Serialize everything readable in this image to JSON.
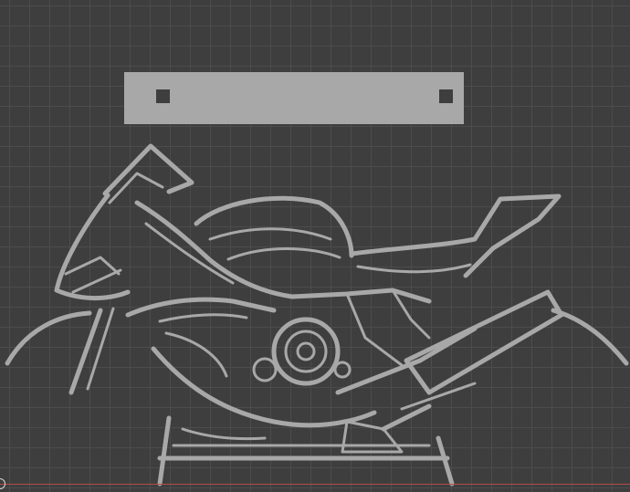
{
  "canvas": {
    "background": "#3e3e3e",
    "grid_color": "#4c4c4c",
    "shape_color": "#a8a8a8",
    "hole_color": "#3e3e3e",
    "edge_color": "#b54a4a"
  },
  "icons": {
    "artwork": "motorcycle-outline-icon",
    "origin": "origin-marker-icon"
  }
}
